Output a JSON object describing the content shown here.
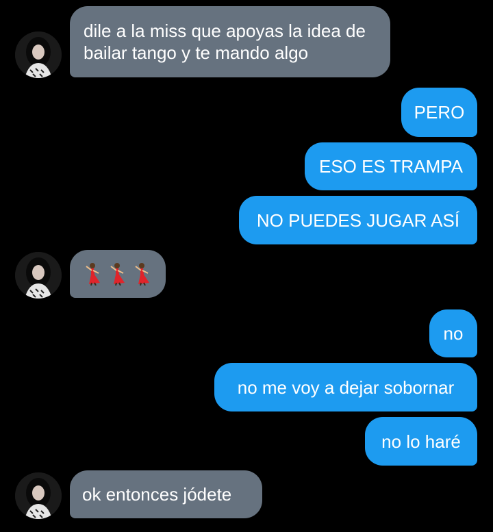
{
  "messages": [
    {
      "id": "m1",
      "side": "in",
      "text": "dile a la miss que apoyas la idea de bailar tango y te mando algo"
    },
    {
      "id": "m2",
      "side": "out",
      "text": "PERO"
    },
    {
      "id": "m3",
      "side": "out",
      "text": "ESO ES TRAMPA"
    },
    {
      "id": "m4",
      "side": "out",
      "text": "NO PUEDES JUGAR ASÍ"
    },
    {
      "id": "m5",
      "side": "in",
      "emoji": [
        "flamenco-dancer-icon",
        "flamenco-dancer-icon",
        "flamenco-dancer-icon"
      ]
    },
    {
      "id": "m6",
      "side": "out",
      "text": "no"
    },
    {
      "id": "m7",
      "side": "out",
      "text": "no me voy a dejar sobornar"
    },
    {
      "id": "m8",
      "side": "out",
      "text": "no lo haré"
    },
    {
      "id": "m9",
      "side": "in",
      "text": "ok entonces jódete"
    }
  ],
  "colors": {
    "background": "#000000",
    "incoming_bubble": "#66727f",
    "outgoing_bubble": "#1d9bf0",
    "text": "#ffffff"
  }
}
